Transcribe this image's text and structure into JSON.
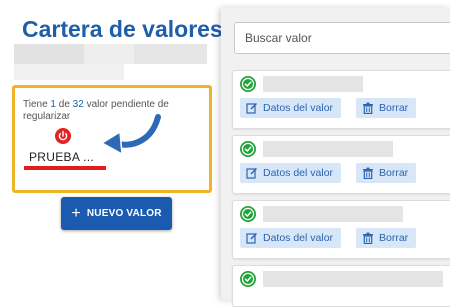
{
  "header": {
    "title": "Cartera de valores"
  },
  "pending": {
    "prefix": "Tiene ",
    "current": "1",
    "middle": " de ",
    "total": "32",
    "suffix": " valor pendiente de regularizar",
    "item_name": "PRUEBA ...",
    "highlight_color": "#f0b429",
    "underline_color": "#e21b1b"
  },
  "actions": {
    "new_value_label": "NUEVO VALOR"
  },
  "search": {
    "placeholder": "Buscar valor"
  },
  "cards": [
    {
      "edit_label": "Datos del valor",
      "delete_label": "Borrar"
    },
    {
      "edit_label": "Datos del valor",
      "delete_label": "Borrar"
    },
    {
      "edit_label": "Datos del valor",
      "delete_label": "Borrar"
    },
    {
      "edit_label": "",
      "delete_label": ""
    }
  ],
  "colors": {
    "accent": "#1a5bb0",
    "check": "#22a33a",
    "button_bg": "#d7e7f8"
  }
}
